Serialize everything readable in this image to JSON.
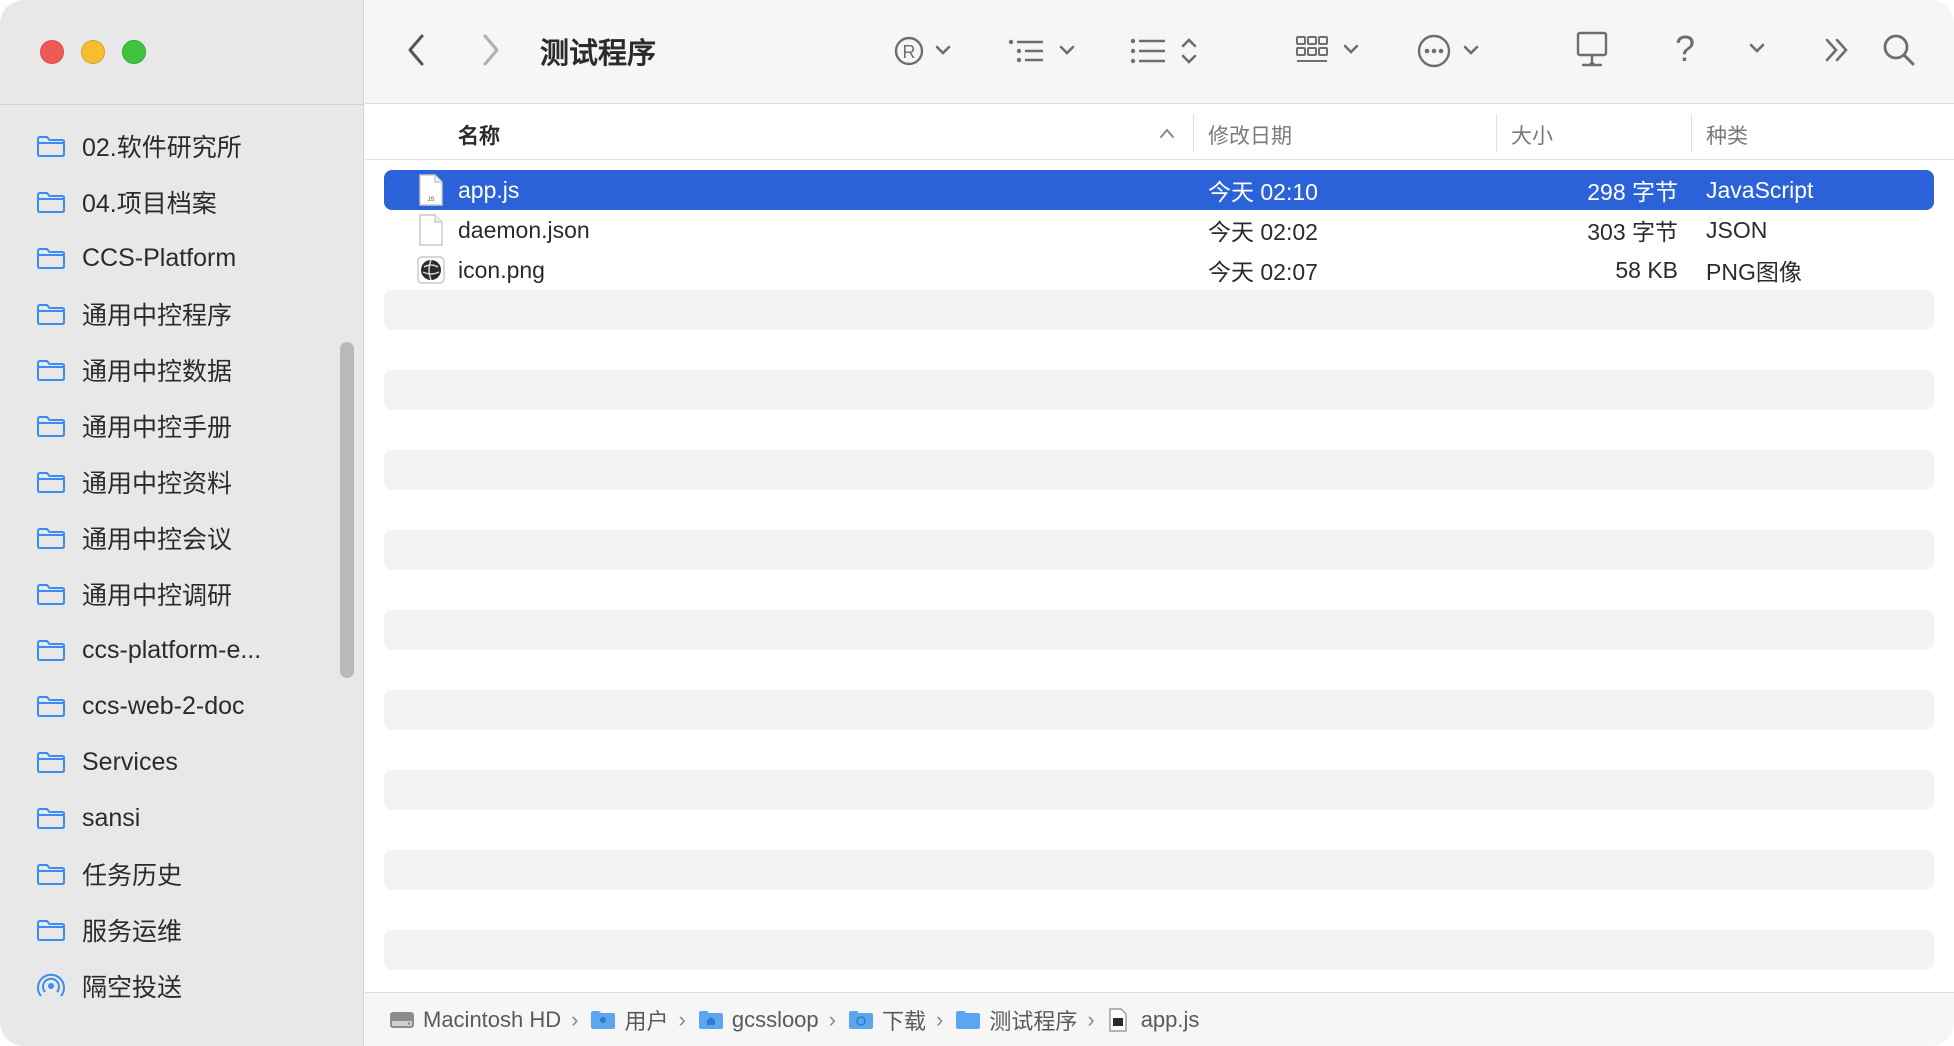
{
  "toolbar": {
    "title": "测试程序",
    "back_icon": "chevron-left-icon",
    "forward_icon": "chevron-right-icon",
    "help_label": "?"
  },
  "sidebar": {
    "items": [
      {
        "label": "02.软件研究所",
        "icon": "folder-icon"
      },
      {
        "label": "04.项目档案",
        "icon": "folder-icon"
      },
      {
        "label": "CCS-Platform",
        "icon": "folder-icon"
      },
      {
        "label": "通用中控程序",
        "icon": "folder-icon"
      },
      {
        "label": "通用中控数据",
        "icon": "folder-icon"
      },
      {
        "label": "通用中控手册",
        "icon": "folder-icon"
      },
      {
        "label": "通用中控资料",
        "icon": "folder-icon"
      },
      {
        "label": "通用中控会议",
        "icon": "folder-icon"
      },
      {
        "label": "通用中控调研",
        "icon": "folder-icon"
      },
      {
        "label": "ccs-platform-e...",
        "icon": "folder-icon"
      },
      {
        "label": "ccs-web-2-doc",
        "icon": "folder-icon"
      },
      {
        "label": "Services",
        "icon": "folder-icon"
      },
      {
        "label": "sansi",
        "icon": "folder-icon"
      },
      {
        "label": "任务历史",
        "icon": "folder-icon"
      },
      {
        "label": "服务运维",
        "icon": "folder-icon"
      },
      {
        "label": "隔空投送",
        "icon": "airdrop-icon"
      }
    ]
  },
  "columns": {
    "name": "名称",
    "date": "修改日期",
    "size": "大小",
    "kind": "种类"
  },
  "files": [
    {
      "name": "app.js",
      "date": "今天 02:10",
      "size": "298 字节",
      "kind": "JavaScript",
      "selected": true,
      "icon": "js-file-icon"
    },
    {
      "name": "daemon.json",
      "date": "今天 02:02",
      "size": "303 字节",
      "kind": "JSON",
      "selected": false,
      "icon": "document-icon"
    },
    {
      "name": "icon.png",
      "date": "今天 02:07",
      "size": "58 KB",
      "kind": "PNG图像",
      "selected": false,
      "icon": "image-file-icon"
    }
  ],
  "pathbar": {
    "crumbs": [
      "Macintosh HD",
      "用户",
      "gcssloop",
      "下载",
      "测试程序",
      "app.js"
    ]
  },
  "colors": {
    "selection": "#2c62d9",
    "folder_icon": "#3d8cf0",
    "sidebar_bg": "#e8e8e8"
  }
}
